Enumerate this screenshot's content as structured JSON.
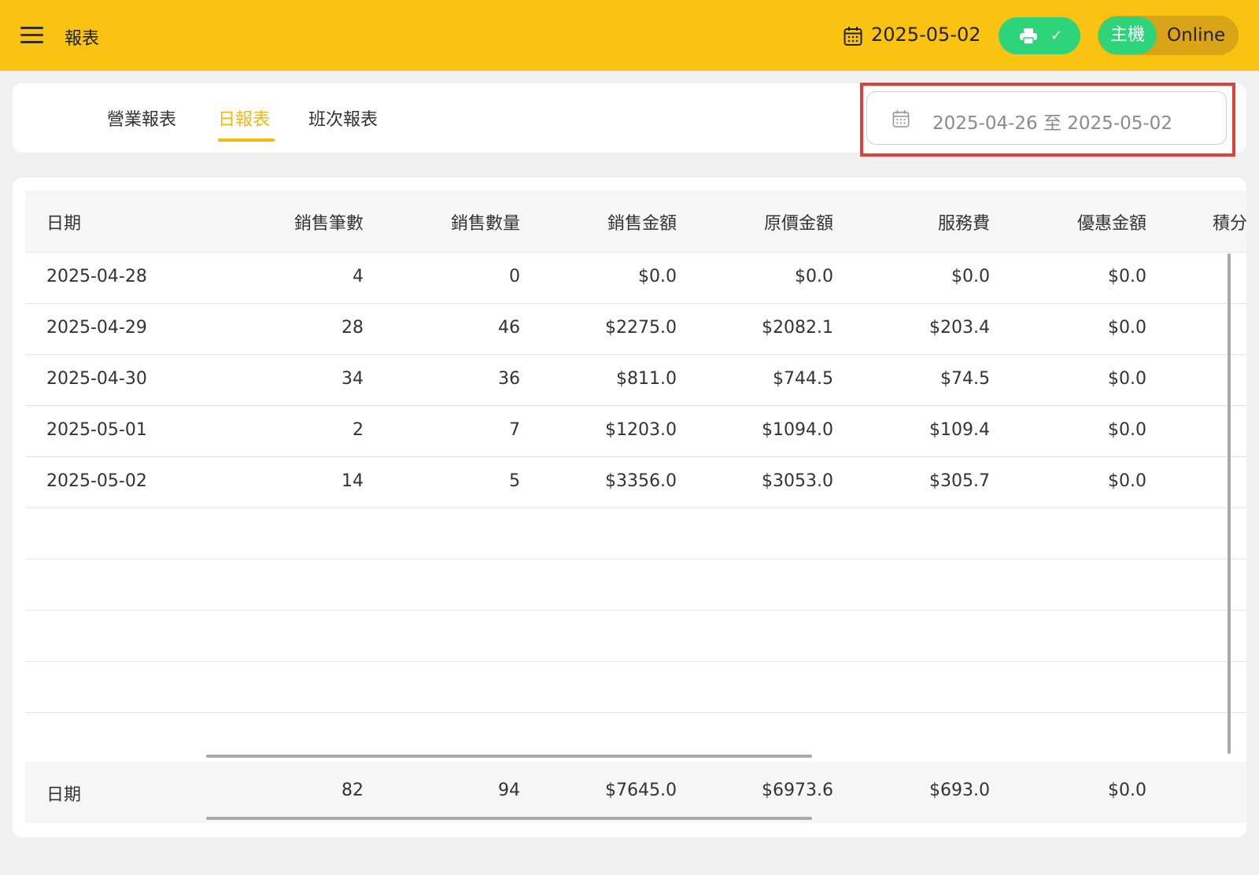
{
  "header": {
    "title": "報表",
    "date": "2025-05-02",
    "printer_status": "✓",
    "host_label": "主機",
    "online_label": "Online",
    "accent_color": "#fbc311",
    "status_color": "#2ed47a"
  },
  "tabs": [
    {
      "label": "營業報表",
      "active": false
    },
    {
      "label": "日報表",
      "active": true
    },
    {
      "label": "班次報表",
      "active": false
    }
  ],
  "date_range": {
    "text": "2025-04-26 至 2025-05-02"
  },
  "table": {
    "columns": [
      "日期",
      "銷售筆數",
      "銷售數量",
      "銷售金額",
      "原價金額",
      "服務費",
      "優惠金額",
      "積分"
    ],
    "rows": [
      [
        "2025-04-28",
        "4",
        "0",
        "$0.0",
        "$0.0",
        "$0.0",
        "$0.0"
      ],
      [
        "2025-04-29",
        "28",
        "46",
        "$2275.0",
        "$2082.1",
        "$203.4",
        "$0.0"
      ],
      [
        "2025-04-30",
        "34",
        "36",
        "$811.0",
        "$744.5",
        "$74.5",
        "$0.0"
      ],
      [
        "2025-05-01",
        "2",
        "7",
        "$1203.0",
        "$1094.0",
        "$109.4",
        "$0.0"
      ],
      [
        "2025-05-02",
        "14",
        "5",
        "$3356.0",
        "$3053.0",
        "$305.7",
        "$0.0"
      ]
    ],
    "footer": [
      "日期",
      "82",
      "94",
      "$7645.0",
      "$6973.6",
      "$693.0",
      "$0.0"
    ]
  }
}
